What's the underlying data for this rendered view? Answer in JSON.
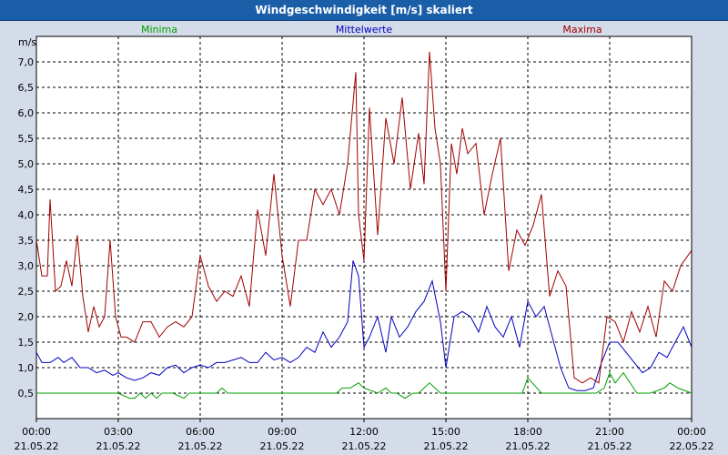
{
  "window_title": "Windgeschwindigkeit [m/s] skaliert",
  "chart_data": {
    "type": "line",
    "title": "Windgeschwindigkeit [m/s] skaliert",
    "ylabel": "m/s",
    "xlabel": "",
    "ylim": [
      0,
      7.5
    ],
    "xlim": [
      0,
      24
    ],
    "grid": true,
    "legend_placement": "top",
    "y_ticks": [
      "0,5",
      "1,0",
      "1,5",
      "2,0",
      "2,5",
      "3,0",
      "3,5",
      "4,0",
      "4,5",
      "5,0",
      "5,5",
      "6,0",
      "6,5",
      "7,0"
    ],
    "y_tick_values": [
      0.5,
      1.0,
      1.5,
      2.0,
      2.5,
      3.0,
      3.5,
      4.0,
      4.5,
      5.0,
      5.5,
      6.0,
      6.5,
      7.0
    ],
    "x_ticks": [
      {
        "x": 0,
        "time": "00:00",
        "date": "21.05.22"
      },
      {
        "x": 3,
        "time": "03:00",
        "date": "21.05.22"
      },
      {
        "x": 6,
        "time": "06:00",
        "date": "21.05.22"
      },
      {
        "x": 9,
        "time": "09:00",
        "date": "21.05.22"
      },
      {
        "x": 12,
        "time": "12:00",
        "date": "21.05.22"
      },
      {
        "x": 15,
        "time": "15:00",
        "date": "21.05.22"
      },
      {
        "x": 18,
        "time": "18:00",
        "date": "21.05.22"
      },
      {
        "x": 21,
        "time": "21:00",
        "date": "21.05.22"
      },
      {
        "x": 24,
        "time": "00:00",
        "date": "22.05.22"
      }
    ],
    "series": [
      {
        "name": "Minima",
        "color": "#00a000",
        "x": [
          0,
          0.4,
          1,
          2,
          2.5,
          3.0,
          3.4,
          3.6,
          3.8,
          4,
          4.2,
          4.4,
          4.6,
          5,
          5.4,
          5.6,
          6,
          6.4,
          6.6,
          6.8,
          7,
          7.5,
          8,
          8.5,
          9,
          9.5,
          10,
          10.5,
          11,
          11.2,
          11.5,
          11.8,
          12,
          12.5,
          12.8,
          13,
          13.2,
          13.5,
          13.8,
          14,
          14.2,
          14.4,
          14.6,
          14.8,
          15,
          15.5,
          16,
          16.5,
          17,
          17.5,
          17.8,
          18,
          18.5,
          19,
          19.5,
          20,
          20.5,
          20.8,
          21,
          21.2,
          21.5,
          22,
          22.5,
          23,
          23.2,
          23.5,
          24
        ],
        "values": [
          0.5,
          0.5,
          0.5,
          0.5,
          0.5,
          0.5,
          0.4,
          0.4,
          0.5,
          0.4,
          0.5,
          0.4,
          0.5,
          0.5,
          0.4,
          0.5,
          0.5,
          0.5,
          0.5,
          0.6,
          0.5,
          0.5,
          0.5,
          0.5,
          0.5,
          0.5,
          0.5,
          0.5,
          0.5,
          0.6,
          0.6,
          0.7,
          0.6,
          0.5,
          0.6,
          0.5,
          0.5,
          0.4,
          0.5,
          0.5,
          0.6,
          0.7,
          0.6,
          0.5,
          0.5,
          0.5,
          0.5,
          0.5,
          0.5,
          0.5,
          0.5,
          0.8,
          0.5,
          0.5,
          0.5,
          0.5,
          0.5,
          0.6,
          0.9,
          0.7,
          0.9,
          0.5,
          0.5,
          0.6,
          0.7,
          0.6,
          0.5
        ]
      },
      {
        "name": "Mittelwerte",
        "color": "#0000c0",
        "x": [
          0,
          0.2,
          0.5,
          0.8,
          1,
          1.3,
          1.6,
          1.9,
          2.2,
          2.5,
          2.8,
          3.0,
          3.3,
          3.6,
          3.9,
          4.2,
          4.5,
          4.8,
          5.1,
          5.4,
          5.7,
          6,
          6.3,
          6.6,
          6.9,
          7.2,
          7.5,
          7.8,
          8.1,
          8.4,
          8.7,
          9,
          9.3,
          9.6,
          9.9,
          10.2,
          10.5,
          10.8,
          11.1,
          11.4,
          11.6,
          11.8,
          12,
          12.2,
          12.5,
          12.8,
          13,
          13.3,
          13.6,
          13.9,
          14.2,
          14.5,
          14.8,
          15,
          15.3,
          15.6,
          15.9,
          16.2,
          16.5,
          16.8,
          17.1,
          17.4,
          17.7,
          18,
          18.3,
          18.6,
          18.9,
          19.2,
          19.5,
          19.8,
          20.1,
          20.4,
          20.7,
          21,
          21.3,
          21.6,
          21.9,
          22.2,
          22.5,
          22.8,
          23.1,
          23.4,
          23.7,
          24
        ],
        "values": [
          1.3,
          1.1,
          1.1,
          1.2,
          1.1,
          1.2,
          1.0,
          1.0,
          0.9,
          0.95,
          0.85,
          0.9,
          0.8,
          0.75,
          0.8,
          0.9,
          0.85,
          1.0,
          1.05,
          0.9,
          1.0,
          1.05,
          1.0,
          1.1,
          1.1,
          1.15,
          1.2,
          1.1,
          1.1,
          1.3,
          1.15,
          1.2,
          1.1,
          1.2,
          1.4,
          1.3,
          1.7,
          1.4,
          1.6,
          1.9,
          3.1,
          2.8,
          1.4,
          1.6,
          2.0,
          1.3,
          2.0,
          1.6,
          1.8,
          2.1,
          2.3,
          2.7,
          1.9,
          1.0,
          2.0,
          2.1,
          2.0,
          1.7,
          2.2,
          1.8,
          1.6,
          2.0,
          1.4,
          2.3,
          2.0,
          2.2,
          1.6,
          1.0,
          0.6,
          0.55,
          0.55,
          0.6,
          1.1,
          1.5,
          1.5,
          1.3,
          1.1,
          0.9,
          1.0,
          1.3,
          1.2,
          1.5,
          1.8,
          1.4
        ]
      },
      {
        "name": "Maxima",
        "color": "#a00000",
        "x": [
          0,
          0.2,
          0.4,
          0.5,
          0.7,
          0.9,
          1.1,
          1.3,
          1.5,
          1.7,
          1.9,
          2.1,
          2.3,
          2.5,
          2.7,
          2.9,
          3.1,
          3.3,
          3.6,
          3.9,
          4.2,
          4.5,
          4.8,
          5.1,
          5.4,
          5.7,
          6,
          6.3,
          6.6,
          6.9,
          7.2,
          7.5,
          7.8,
          8.1,
          8.4,
          8.7,
          9,
          9.3,
          9.6,
          9.9,
          10.2,
          10.5,
          10.8,
          11.1,
          11.4,
          11.7,
          11.8,
          12,
          12.2,
          12.5,
          12.8,
          13.1,
          13.4,
          13.7,
          14,
          14.2,
          14.4,
          14.6,
          14.8,
          15,
          15.2,
          15.4,
          15.6,
          15.8,
          16.1,
          16.4,
          16.7,
          17,
          17.3,
          17.6,
          17.9,
          18.2,
          18.5,
          18.8,
          19.1,
          19.4,
          19.7,
          20,
          20.3,
          20.6,
          20.9,
          21.2,
          21.5,
          21.8,
          22.1,
          22.4,
          22.7,
          23,
          23.3,
          23.6,
          24
        ],
        "values": [
          3.5,
          2.8,
          2.8,
          4.3,
          2.5,
          2.6,
          3.1,
          2.6,
          3.6,
          2.4,
          1.7,
          2.2,
          1.8,
          2.0,
          3.5,
          2.0,
          1.6,
          1.6,
          1.5,
          1.9,
          1.9,
          1.6,
          1.8,
          1.9,
          1.8,
          2.0,
          3.2,
          2.6,
          2.3,
          2.5,
          2.4,
          2.8,
          2.2,
          4.1,
          3.2,
          4.8,
          3.2,
          2.2,
          3.5,
          3.5,
          4.5,
          4.2,
          4.5,
          4.0,
          5.0,
          6.8,
          4.0,
          3.1,
          6.1,
          3.6,
          5.9,
          5.0,
          6.3,
          4.5,
          5.6,
          4.6,
          7.2,
          5.7,
          5.0,
          2.5,
          5.4,
          4.8,
          5.7,
          5.2,
          5.4,
          4.0,
          4.8,
          5.5,
          2.9,
          3.7,
          3.4,
          3.8,
          4.4,
          2.4,
          2.9,
          2.6,
          0.8,
          0.7,
          0.8,
          0.7,
          2.0,
          1.9,
          1.5,
          2.1,
          1.7,
          2.2,
          1.6,
          2.7,
          2.5,
          3.0,
          3.3
        ]
      }
    ]
  }
}
